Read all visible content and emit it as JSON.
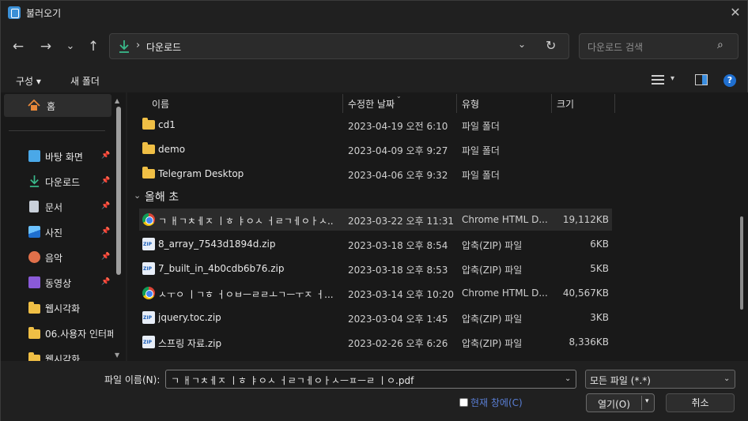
{
  "window": {
    "title": "불러오기",
    "close_glyph": "✕"
  },
  "nav": {
    "back": "←",
    "forward": "→",
    "recent": "⌄",
    "up": "↑"
  },
  "address": {
    "separator": "›",
    "path": "다운로드",
    "chevron": "⌄",
    "refresh": "↻"
  },
  "search": {
    "placeholder": "다운로드 검색",
    "icon": "⌕"
  },
  "toolbar": {
    "organize": "구성 ▾",
    "new_folder": "새 폴더",
    "view_dropdown": "▾",
    "help": "?"
  },
  "sidebar": {
    "home": "홈",
    "items": [
      {
        "label": "바탕 화면",
        "pinned": true,
        "icon": "desktop-icon",
        "color": "#4aa8e8"
      },
      {
        "label": "다운로드",
        "pinned": true,
        "icon": "download-icon",
        "color": "#39b98a"
      },
      {
        "label": "문서",
        "pinned": true,
        "icon": "document-icon",
        "color": "#c8d0da"
      },
      {
        "label": "사진",
        "pinned": true,
        "icon": "pictures-icon",
        "color": "#3a8fd6"
      },
      {
        "label": "음악",
        "pinned": true,
        "icon": "music-icon",
        "color": "#e0704a"
      },
      {
        "label": "동영상",
        "pinned": true,
        "icon": "video-icon",
        "color": "#8a5ad8"
      },
      {
        "label": "웹시각화",
        "pinned": false,
        "icon": "folder-icon",
        "color": "#f0bf45"
      },
      {
        "label": "06.사용자 인터페",
        "pinned": false,
        "icon": "folder-icon",
        "color": "#f0bf45"
      },
      {
        "label": "웹시각화",
        "pinned": false,
        "icon": "folder-icon",
        "color": "#f0bf45"
      }
    ]
  },
  "columns": {
    "name": "이름",
    "modified": "수정한 날짜",
    "type": "유형",
    "size": "크기"
  },
  "folders": [
    {
      "name": "cd1",
      "date": "2023-04-19 오전 6:10",
      "type": "파일 폴더"
    },
    {
      "name": "demo",
      "date": "2023-04-09 오후 9:27",
      "type": "파일 폴더"
    },
    {
      "name": "Telegram Desktop",
      "date": "2023-04-06 오후 9:32",
      "type": "파일 폴더"
    }
  ],
  "group_label": "올해 초",
  "files": [
    {
      "icon": "chrome-icon",
      "name": "ㄱ ㅐㄱㅊㅔㅈ ㅣㅎ ㅑㅇㅅ ㅓㄹㄱㅔㅇㅏㅅ...",
      "date": "2023-03-22 오후 11:31",
      "type": "Chrome HTML D...",
      "size": "19,112KB",
      "selected": true
    },
    {
      "icon": "zip-icon",
      "name": "8_array_7543d1894d.zip",
      "date": "2023-03-18 오후 8:54",
      "type": "압축(ZIP) 파일",
      "size": "6KB",
      "selected": false
    },
    {
      "icon": "zip-icon",
      "name": "7_built_in_4b0cdb6b76.zip",
      "date": "2023-03-18 오후 8:53",
      "type": "압축(ZIP) 파일",
      "size": "5KB",
      "selected": false
    },
    {
      "icon": "chrome-icon",
      "name": "ㅅㅜㅇ ㅣㄱㅎ ㅓㅇㅂㅡㄹㄹㅗㄱㅡㅜㅈ ㅓ...",
      "date": "2023-03-14 오후 10:20",
      "type": "Chrome HTML D...",
      "size": "40,567KB",
      "selected": false
    },
    {
      "icon": "zip-icon",
      "name": "jquery.toc.zip",
      "date": "2023-03-04 오후 1:45",
      "type": "압축(ZIP) 파일",
      "size": "3KB",
      "selected": false
    },
    {
      "icon": "zip-icon",
      "name": "스프링 자료.zip",
      "date": "2023-02-26 오후 6:26",
      "type": "압축(ZIP) 파일",
      "size": "8,336KB",
      "selected": false
    }
  ],
  "footer": {
    "filename_label": "파일 이름(N):",
    "filename_value": "ㄱ ㅐㄱㅊㅔㅈ ㅣㅎ ㅑㅇㅅ ㅓㄹㄱㅔㅇㅏㅅㅡㅍㅡㄹ ㅣㅇ.pdf",
    "filetype": "모든 파일 (*.*)",
    "readonly_label": "현재 창에(C)",
    "open": "열기(O)",
    "open_dropdown": "▾",
    "cancel": "취소",
    "dropdown_chevron": "⌄"
  },
  "accent_color": "#1f6fd0"
}
